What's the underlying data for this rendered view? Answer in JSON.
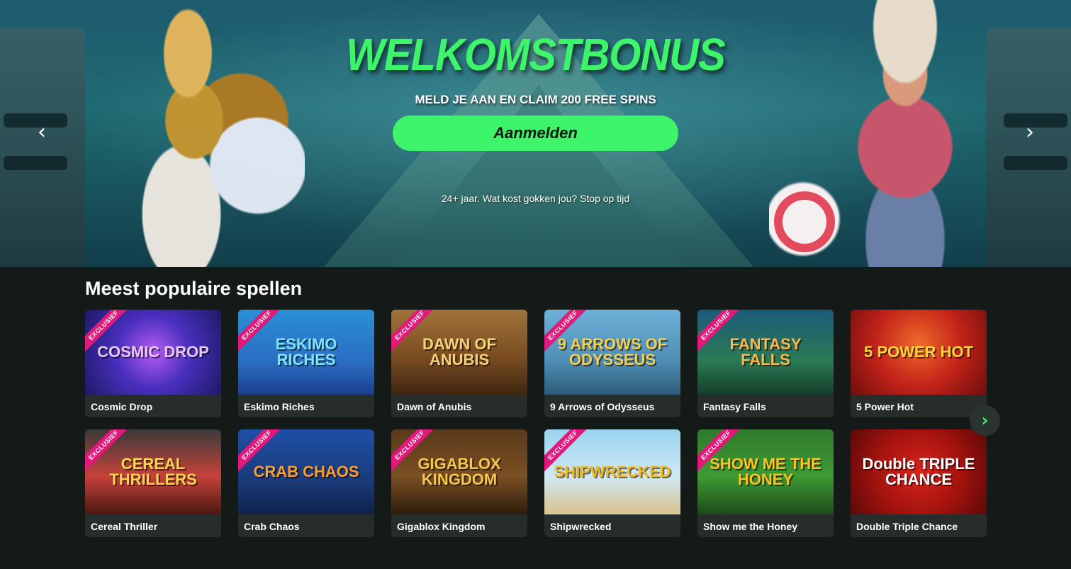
{
  "hero": {
    "title": "WELKOMSTBONUS",
    "subtitle": "MELD JE AAN EN CLAIM 200 FREE SPINS",
    "cta_label": "Aanmelden",
    "disclaimer": "24+ jaar. Wat kost gokken jou? Stop op tijd",
    "prev_icon": "‹",
    "next_icon": "›"
  },
  "games": {
    "section_title": "Meest populaire spellen",
    "ribbon_text": "EXCLUSIEF",
    "next_icon": "›",
    "colors": {
      "accent": "#3ef46a",
      "ribbon": "#e0197a",
      "card_bg": "#262d2a"
    },
    "items": [
      {
        "name": "Cosmic Drop",
        "thumb_text": "COSMIC DROP",
        "exclusive": true,
        "bg": "radial-gradient(circle at 50% 50%, #b45cf0 0%, #4a2fbf 45%, #1d1a66 100%)",
        "fg": "#e7c6ff"
      },
      {
        "name": "Eskimo Riches",
        "thumb_text": "ESKIMO RICHES",
        "exclusive": true,
        "bg": "linear-gradient(180deg, #2a8fd6 0%, #2b6fc4 60%, #1b3f8c 100%)",
        "fg": "#7fe3ff"
      },
      {
        "name": "Dawn of Anubis",
        "thumb_text": "DAWN OF ANUBIS",
        "exclusive": true,
        "bg": "linear-gradient(180deg, #a0733b 0%, #7a4d21 55%, #3f2611 100%)",
        "fg": "#f5d27a"
      },
      {
        "name": "9 Arrows of Odysseus",
        "thumb_text": "9 ARROWS OF ODYSSEUS",
        "exclusive": true,
        "bg": "linear-gradient(180deg, #6fb0d8 0%, #4f8fb6 60%, #2d5a78 100%)",
        "fg": "#f4cd55"
      },
      {
        "name": "Fantasy Falls",
        "thumb_text": "FANTASY FALLS",
        "exclusive": true,
        "bg": "linear-gradient(180deg, #1e5a7a 0%, #2a7a55 60%, #153e2b 100%)",
        "fg": "#ffb74a"
      },
      {
        "name": "5 Power Hot",
        "thumb_text": "5 POWER HOT",
        "exclusive": false,
        "bg": "radial-gradient(circle at 50% 40%, #f06a2b 0%, #c32319 50%, #6e0e0c 100%)",
        "fg": "#ffd23c"
      },
      {
        "name": "Cereal Thriller",
        "thumb_text": "CEREAL THRILLERS",
        "exclusive": true,
        "bg": "linear-gradient(180deg, #3a3a3a 0%, #c6423a 55%, #4a1710 100%)",
        "fg": "#ffd54a"
      },
      {
        "name": "Crab Chaos",
        "thumb_text": "CRAB CHAOS",
        "exclusive": true,
        "bg": "linear-gradient(180deg, #1f4fa6 0%, #1a3b7a 60%, #0f224a 100%)",
        "fg": "#ff9c2f"
      },
      {
        "name": "Gigablox Kingdom",
        "thumb_text": "GIGABLOX KINGDOM",
        "exclusive": true,
        "bg": "linear-gradient(180deg, #5a3a1c 0%, #7a4f23 55%, #2f1d0d 100%)",
        "fg": "#f7c64c"
      },
      {
        "name": "Shipwrecked",
        "thumb_text": "SHIPWRECKED",
        "exclusive": true,
        "bg": "linear-gradient(180deg, #9ad4f0 0%, #cfe9f4 55%, #d9c28e 100%)",
        "fg": "#f2b81f"
      },
      {
        "name": "Show me the Honey",
        "thumb_text": "SHOW ME THE HONEY",
        "exclusive": true,
        "bg": "linear-gradient(180deg, #2f7a2c 0%, #3f9a33 55%, #1d4a18 100%)",
        "fg": "#ffc21f"
      },
      {
        "name": "Double Triple Chance",
        "thumb_text": "Double TRIPLE CHANCE",
        "exclusive": false,
        "bg": "radial-gradient(circle at 50% 50%, #d8241c 0%, #a1120e 55%, #5a0907 100%)",
        "fg": "#ffffff"
      }
    ]
  }
}
